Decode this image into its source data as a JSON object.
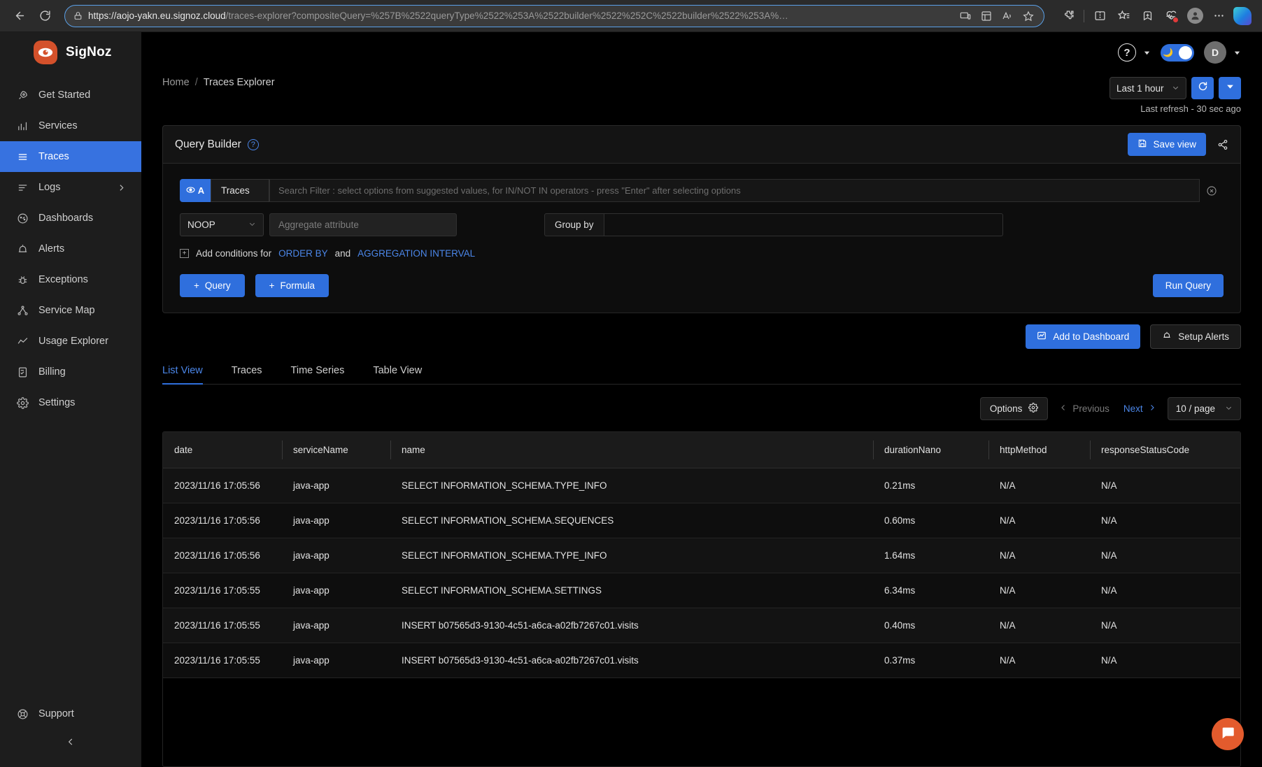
{
  "browser": {
    "url_bold": "https://aojo-yakn.eu.signoz.cloud",
    "url_rest": "/traces-explorer?compositeQuery=%257B%2522queryType%2522%253A%2522builder%2522%252C%2522builder%2522%253A%…",
    "back_icon": "back-arrow-icon",
    "reload_icon": "reload-icon",
    "lock_icon": "lock-icon"
  },
  "sidebar": {
    "brand": "SigNoz",
    "items": [
      {
        "label": "Get Started",
        "icon": "rocket-icon",
        "active": false,
        "expandable": false
      },
      {
        "label": "Services",
        "icon": "bar-chart-icon",
        "active": false,
        "expandable": false
      },
      {
        "label": "Traces",
        "icon": "list-icon",
        "active": true,
        "expandable": false
      },
      {
        "label": "Logs",
        "icon": "logs-icon",
        "active": false,
        "expandable": true
      },
      {
        "label": "Dashboards",
        "icon": "dashboard-icon",
        "active": false,
        "expandable": false
      },
      {
        "label": "Alerts",
        "icon": "bell-alert-icon",
        "active": false,
        "expandable": false
      },
      {
        "label": "Exceptions",
        "icon": "bug-icon",
        "active": false,
        "expandable": false
      },
      {
        "label": "Service Map",
        "icon": "network-icon",
        "active": false,
        "expandable": false
      },
      {
        "label": "Usage Explorer",
        "icon": "line-chart-icon",
        "active": false,
        "expandable": false
      },
      {
        "label": "Billing",
        "icon": "receipt-icon",
        "active": false,
        "expandable": false
      },
      {
        "label": "Settings",
        "icon": "gear-icon",
        "active": false,
        "expandable": false
      }
    ],
    "support_label": "Support",
    "collapse_icon": "chevron-left-icon"
  },
  "topbar": {
    "help_icon": "question-mark-icon",
    "theme_toggle_state": "dark",
    "theme_icon": "moon-icon",
    "avatar_initial": "D"
  },
  "breadcrumb": {
    "home": "Home",
    "separator": "/",
    "current": "Traces Explorer"
  },
  "timerange": {
    "value": "Last 1 hour",
    "refresh_icon": "refresh-icon",
    "dropdown_icon": "caret-down-icon",
    "last_refresh": "Last refresh - 30 sec ago"
  },
  "query_builder": {
    "title": "Query Builder",
    "help_icon": "question-circle-icon",
    "save_view_label": "Save view",
    "save_icon": "floppy-disk-icon",
    "share_icon": "share-icon",
    "query_letter": "A",
    "eye_icon": "eye-icon",
    "datasource": "Traces",
    "search_placeholder": "Search Filter : select options from suggested values, for IN/NOT IN operators - press \"Enter\" after selecting options",
    "clear_icon": "clear-circle-icon",
    "aggregate_operator": "NOOP",
    "aggregate_attribute_placeholder": "Aggregate attribute",
    "group_by_label": "Group by",
    "group_by_value": "",
    "add_conditions_prefix": "Add conditions for",
    "order_by_link": "ORDER BY",
    "and_text": "and",
    "aggregation_interval_link": "AGGREGATION INTERVAL",
    "add_query_label": "Query",
    "add_formula_label": "Formula",
    "run_query_label": "Run Query"
  },
  "actions": {
    "add_to_dashboard_label": "Add to Dashboard",
    "add_to_dashboard_icon": "chart-icon",
    "setup_alerts_label": "Setup Alerts",
    "setup_alerts_icon": "alarm-icon"
  },
  "tabs": [
    {
      "label": "List View",
      "active": true
    },
    {
      "label": "Traces",
      "active": false
    },
    {
      "label": "Time Series",
      "active": false
    },
    {
      "label": "Table View",
      "active": false
    }
  ],
  "toolbar": {
    "options_label": "Options",
    "options_icon": "gear-icon",
    "previous_label": "Previous",
    "previous_icon": "chevron-left-icon",
    "next_label": "Next",
    "next_icon": "chevron-right-icon",
    "per_page_value": "10 / page",
    "per_page_icon": "caret-down-icon"
  },
  "table": {
    "columns": [
      "date",
      "serviceName",
      "name",
      "durationNano",
      "httpMethod",
      "responseStatusCode"
    ],
    "rows": [
      [
        "2023/11/16 17:05:56",
        "java-app",
        "SELECT INFORMATION_SCHEMA.TYPE_INFO",
        "0.21ms",
        "N/A",
        "N/A"
      ],
      [
        "2023/11/16 17:05:56",
        "java-app",
        "SELECT INFORMATION_SCHEMA.SEQUENCES",
        "0.60ms",
        "N/A",
        "N/A"
      ],
      [
        "2023/11/16 17:05:56",
        "java-app",
        "SELECT INFORMATION_SCHEMA.TYPE_INFO",
        "1.64ms",
        "N/A",
        "N/A"
      ],
      [
        "2023/11/16 17:05:55",
        "java-app",
        "SELECT INFORMATION_SCHEMA.SETTINGS",
        "6.34ms",
        "N/A",
        "N/A"
      ],
      [
        "2023/11/16 17:05:55",
        "java-app",
        "INSERT b07565d3-9130-4c51-a6ca-a02fb7267c01.visits",
        "0.40ms",
        "N/A",
        "N/A"
      ],
      [
        "2023/11/16 17:05:55",
        "java-app",
        "INSERT b07565d3-9130-4c51-a6ca-a02fb7267c01.visits",
        "0.37ms",
        "N/A",
        "N/A"
      ]
    ]
  },
  "chat": {
    "icon": "chat-bubble-icon",
    "color": "#e35b2d"
  },
  "colors": {
    "accent": "#2f6fdd",
    "brand": "#d4512b",
    "link": "#4b86e8"
  }
}
